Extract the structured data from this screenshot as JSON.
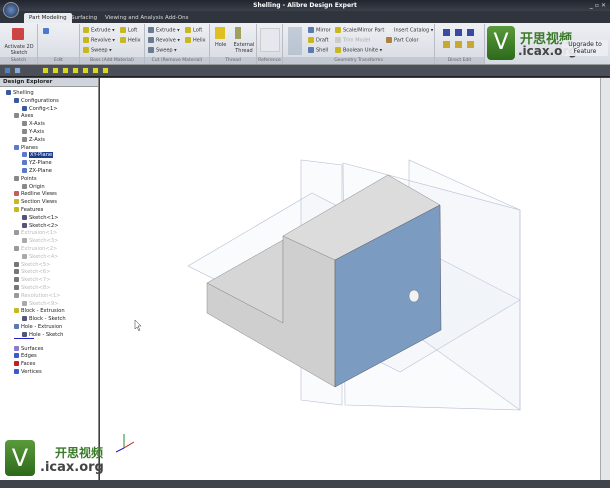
{
  "window": {
    "title": "Shelling - Alibre Design Expert"
  },
  "tabs": [
    "Part Modeling",
    "Surfacing",
    "Viewing and Analysis",
    "Add-Ons"
  ],
  "ribbon": {
    "sketch": {
      "label": "Sketch",
      "activate": "Activate 2D Sketch"
    },
    "edit": {
      "label": "Edit"
    },
    "boss": {
      "label": "Boss (Add Material)",
      "extrude": "Extrude",
      "revolve": "Revolve",
      "sweep": "Sweep",
      "loft": "Loft",
      "helix": "Helix"
    },
    "cut": {
      "label": "Cut (Remove Material)",
      "extrude": "Extrude",
      "revolve": "Revolve",
      "sweep": "Sweep",
      "loft": "Loft",
      "helix": "Helix"
    },
    "thread": {
      "label": "Thread",
      "hole": "Hole",
      "external": "External Thread"
    },
    "reference": {
      "label": "Reference"
    },
    "geometry": {
      "label": "Geometry Transforms",
      "mirror": "Mirror",
      "draft": "Draft",
      "shell": "Shell",
      "scale": "Scale/Mirror Part",
      "trim": "Trim Model",
      "boolean": "Boolean Unite",
      "insert_catalog": "Insert Catalog",
      "part_color": "Part Color"
    },
    "direct": {
      "label": "Direct Edit"
    },
    "upgrade": "Upgrade to Feature"
  },
  "explorer": {
    "title": "Design Explorer",
    "items": [
      "Shelling",
      "Configurations",
      "Config<1>",
      "Axes",
      "X-Axis",
      "Y-Axis",
      "Z-Axis",
      "Planes",
      "XY-Plane",
      "YZ-Plane",
      "ZX-Plane",
      "Points",
      "Origin",
      "Redline Views",
      "Section Views",
      "Features",
      "Sketch<1>",
      "Sketch<2>",
      "Extrusion<1>",
      "Sketch<3>",
      "Extrusion<2>",
      "Sketch<4>",
      "Sketch<5>",
      "Sketch<6>",
      "Sketch<7>",
      "Sketch<8>",
      "Revolution<1>",
      "Sketch<9>",
      "Block - Extrusion",
      "Block - Sketch",
      "Hole - Extrusion",
      "Hole - Sketch",
      "Surfaces",
      "Edges",
      "Faces",
      "Vertices"
    ]
  },
  "viewport": {
    "colors": {
      "face": "#7b9cc0",
      "grey": "#d4d4d4"
    }
  },
  "watermark": {
    "cn": "开思视频",
    "url": ".icax.org",
    "letter": "V"
  }
}
